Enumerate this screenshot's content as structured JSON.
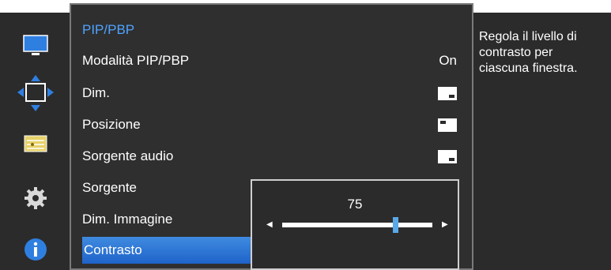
{
  "sidebar": {
    "icons": [
      "monitor-icon",
      "move-icon",
      "settings-list-icon",
      "gear-icon",
      "info-icon"
    ]
  },
  "menu": {
    "title": "PIP/PBP",
    "items": [
      {
        "label": "Modalità PIP/PBP",
        "value": "On"
      },
      {
        "label": "Dim.",
        "value_icon": "pip-size-icon"
      },
      {
        "label": "Posizione",
        "value_icon": "pip-position-icon"
      },
      {
        "label": "Sorgente audio",
        "value_icon": "audio-source-icon"
      },
      {
        "label": "Sorgente"
      },
      {
        "label": "Dim. Immagine"
      },
      {
        "label": "Contrasto",
        "selected": true
      }
    ]
  },
  "slider": {
    "value": "75",
    "level": 0.75
  },
  "help": {
    "text": "Regola il livello di contrasto per ciascuna finestra."
  },
  "colors": {
    "accent": "#4fa3ff",
    "selected": "#2a74d6",
    "background": "#2b2b2b"
  }
}
